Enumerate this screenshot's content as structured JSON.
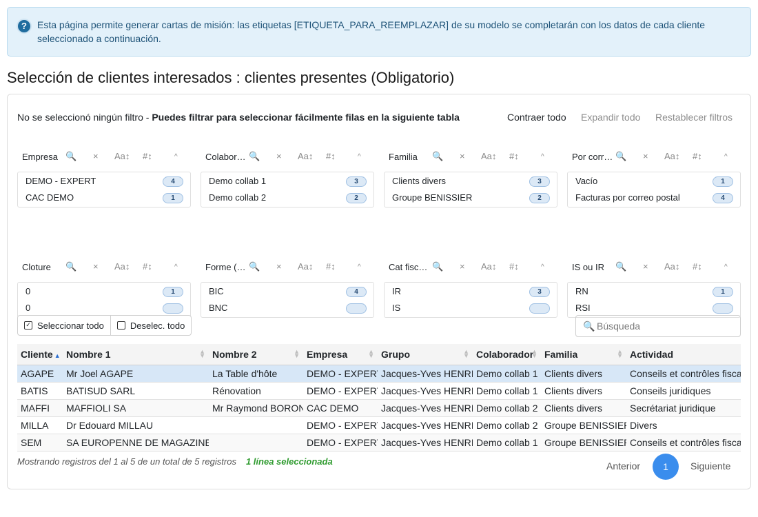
{
  "info": {
    "text": "Esta página permite generar cartas de misión: las etiquetas [ETIQUETA_PARA_REEMPLAZAR] de su modelo se completarán con los datos de cada cliente seleccionado a continuación."
  },
  "page_title": "Selección de clientes interesados : clientes presentes (Obligatorio)",
  "filters": {
    "status_prefix": "No se seleccionó ningún filtro - ",
    "status_bold": "Puedes filtrar para seleccionar fácilmente filas en la siguiente tabla",
    "collapse_all": "Contraer todo",
    "expand_all": "Expandir todo",
    "reset": "Restablecer filtros"
  },
  "pane_icons": {
    "search": "🔍",
    "clear": "×",
    "aa": "Aa↕",
    "num": "#↕",
    "caret": "^"
  },
  "panes": [
    {
      "title": "Empresa",
      "rows": [
        {
          "label": "DEMO - EXPERT",
          "count": "4"
        },
        {
          "label": "CAC DEMO",
          "count": "1"
        }
      ]
    },
    {
      "title": "Colabora...",
      "rows": [
        {
          "label": "Demo collab 1",
          "count": "3"
        },
        {
          "label": "Demo collab 2",
          "count": "2"
        }
      ]
    },
    {
      "title": "Familia",
      "rows": [
        {
          "label": "Clients divers",
          "count": "3"
        },
        {
          "label": "Groupe BENISSIER",
          "count": "2"
        }
      ]
    },
    {
      "title": "Por correo",
      "rows": [
        {
          "label": "Vacío",
          "count": "1"
        },
        {
          "label": "Facturas por correo postal",
          "count": "4"
        }
      ]
    },
    {
      "title": "Cloture",
      "rows": [
        {
          "label": "0",
          "count": "1"
        },
        {
          "label": "0",
          "count": ""
        }
      ]
    },
    {
      "title": "Forme (s...",
      "rows": [
        {
          "label": "BIC",
          "count": "4"
        },
        {
          "label": "BNC",
          "count": ""
        }
      ]
    },
    {
      "title": "Cat fiscal...",
      "rows": [
        {
          "label": "IR",
          "count": "3"
        },
        {
          "label": "IS",
          "count": ""
        }
      ]
    },
    {
      "title": "IS ou IR",
      "rows": [
        {
          "label": "RN",
          "count": "1"
        },
        {
          "label": "RSI",
          "count": ""
        }
      ]
    }
  ],
  "selection": {
    "select_all": "Seleccionar todo",
    "deselect_all": "Deselec. todo"
  },
  "search": {
    "placeholder": "Búsqueda",
    "value": ""
  },
  "table": {
    "columns": [
      "Cliente",
      "Nombre 1",
      "Nombre 2",
      "Empresa",
      "Grupo",
      "Colaborador",
      "Familia",
      "Actividad"
    ],
    "rows": [
      [
        "AGAPE",
        "Mr Joel AGAPE",
        "La Table d'hôte",
        "DEMO - EXPERT",
        "Jacques-Yves HENRI",
        "Demo collab 1",
        "Clients divers",
        "Conseils et contrôles fiscaux"
      ],
      [
        "BATIS",
        "BATISUD SARL",
        "Rénovation",
        "DEMO - EXPERT",
        "Jacques-Yves HENRI",
        "Demo collab 1",
        "Clients divers",
        "Conseils juridiques"
      ],
      [
        "MAFFI",
        "MAFFIOLI SA",
        "Mr Raymond BORON",
        "CAC DEMO",
        "Jacques-Yves HENRI",
        "Demo collab 2",
        "Clients divers",
        "Secrétariat juridique"
      ],
      [
        "MILLA",
        "Dr Edouard MILLAU",
        "",
        "DEMO - EXPERT",
        "Jacques-Yves HENRI",
        "Demo collab 2",
        "Groupe BENISSIER",
        "Divers"
      ],
      [
        "SEM",
        "SA EUROPENNE DE MAGAZINES",
        "",
        "DEMO - EXPERT",
        "Jacques-Yves HENRI",
        "Demo collab 1",
        "Groupe BENISSIER",
        "Conseils et contrôles fiscaux"
      ]
    ],
    "selected_row": 0
  },
  "footer": {
    "count_text": "Mostrando registros del 1 al 5 de un total de 5 registros",
    "selected_text": "1 línea seleccionada",
    "prev": "Anterior",
    "page": "1",
    "next": "Siguiente"
  }
}
